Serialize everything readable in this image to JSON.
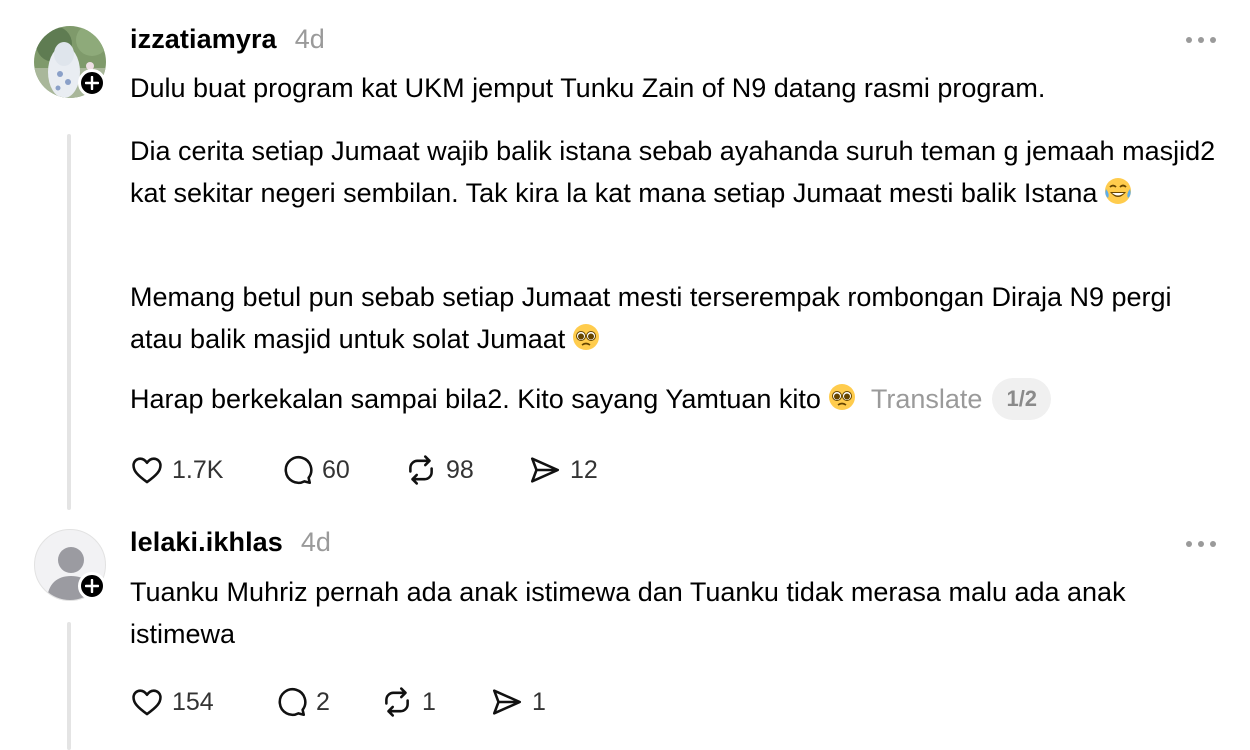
{
  "posts": [
    {
      "username": "izzatiamyra",
      "time": "4d",
      "paragraphs": [
        "Dulu buat program kat UKM jemput Tunku Zain of N9 datang rasmi program.",
        "Dia cerita setiap Jumaat wajib balik istana sebab ayahanda suruh teman g jemaah masjid2 kat sekitar negeri sembilan. Tak kira la kat mana setiap Jumaat mesti balik Istana",
        "Memang betul pun sebab setiap Jumaat mesti terserempak rombongan Diraja N9 pergi atau balik masjid untuk solat Jumaat",
        "Harap berkekalan sampai bila2. Kito sayang Yamtuan kito"
      ],
      "emoji": [
        "laughing-tears",
        "pleading-face",
        "pleading-face"
      ],
      "translate_label": "Translate",
      "pager": "1/2",
      "likes": "1.7K",
      "replies": "60",
      "reposts": "98",
      "shares": "12"
    },
    {
      "username": "lelaki.ikhlas",
      "time": "4d",
      "paragraphs": [
        "Tuanku Muhriz pernah ada anak istimewa dan Tuanku tidak merasa malu ada anak istimewa"
      ],
      "likes": "154",
      "replies": "2",
      "reposts": "1",
      "shares": "1"
    }
  ],
  "colors": {
    "muted": "#9a9a9a",
    "thread_line": "#e4e4e4",
    "badge": "#000000"
  }
}
